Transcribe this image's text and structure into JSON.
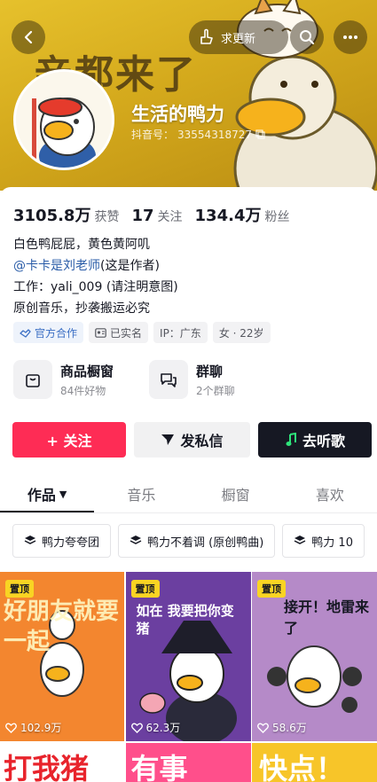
{
  "header": {
    "back_icon": "chevron-left-icon",
    "update_request_label": "求更新",
    "search_icon": "search-icon",
    "more_icon": "more-dots-icon",
    "banner_text": "亲都来了"
  },
  "profile": {
    "nickname": "生活的鸭力",
    "douyin_id_label": "抖音号：",
    "douyin_id": "33554318727",
    "stats": [
      {
        "value": "3105.8万",
        "label": "获赞"
      },
      {
        "value": "17",
        "label": "关注"
      },
      {
        "value": "134.4万",
        "label": "粉丝"
      }
    ],
    "bio": {
      "line1": "白色鸭屁屁，黄色黄阿叽",
      "mention": "@卡卡是刘老师",
      "mention_suffix": "(这是作者)",
      "line3": "工作：yali_009 (请注明意图)",
      "line4": "原创音乐，抄袭搬运必究"
    },
    "tags": [
      "官方合作",
      "已实名",
      "IP：广东",
      "女 · 22岁"
    ]
  },
  "entries": [
    {
      "title": "商品橱窗",
      "subtitle": "84件好物"
    },
    {
      "title": "群聊",
      "subtitle": "2个群聊"
    }
  ],
  "actions": {
    "follow": "+ 关注",
    "message": "发私信",
    "listen": "去听歌"
  },
  "tabs": [
    "作品",
    "音乐",
    "橱窗",
    "喜欢"
  ],
  "collections": [
    "鸭力夸夸团",
    "鸭力不着调 (原创鸭曲)",
    "鸭力 10"
  ],
  "videos": [
    {
      "pinned": "置顶",
      "likes": "102.9万",
      "cover": "好朋友就要一起",
      "bg": "#f3862f"
    },
    {
      "pinned": "置顶",
      "likes": "62.3万",
      "cover": "如在 我要把你变猪",
      "bg": "#6b3fa0"
    },
    {
      "pinned": "置顶",
      "likes": "58.6万",
      "cover": "接开！地雷来了",
      "bg": "#b58ac8"
    },
    {
      "cover": "打我猪",
      "bg": "#ffffff"
    },
    {
      "cover": "有事",
      "bg": "#ff4f8b"
    },
    {
      "cover": "快点！",
      "bg": "#f7c529"
    }
  ]
}
